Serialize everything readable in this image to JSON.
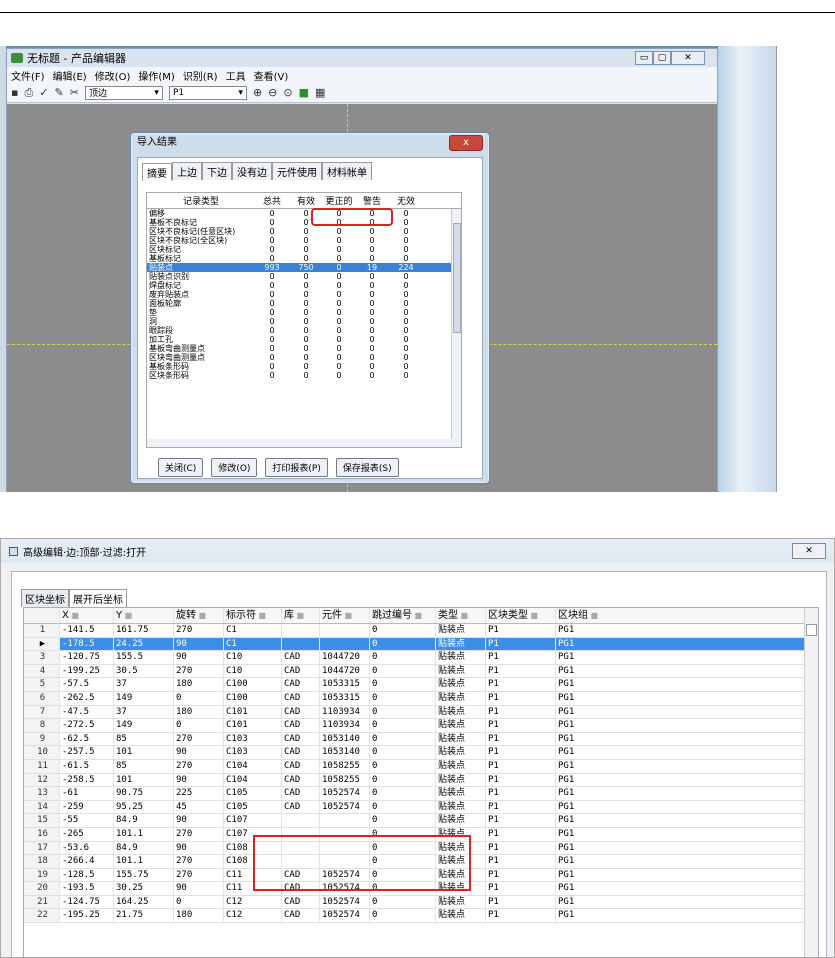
{
  "top": {
    "window_title": "无标题 - 产品编辑器",
    "menu": [
      "文件(F)",
      "编辑(E)",
      "修改(O)",
      "操作(M)",
      "识别(R)",
      "工具",
      "查看(V)"
    ],
    "toolbar": {
      "side_select": "顶边",
      "panel_select": "P1"
    },
    "dialog": {
      "title": "导入结果",
      "close": "x",
      "tabs": [
        "摘要",
        "上边",
        "下边",
        "没有边",
        "元件使用",
        "材料帐单"
      ],
      "columns": [
        "记录类型",
        "总共",
        "有效",
        "更正的",
        "警告",
        "无效"
      ],
      "rows": [
        [
          "偏移",
          "0",
          "0",
          "0",
          "0",
          "0"
        ],
        [
          "基板不良标记",
          "0",
          "0",
          "0",
          "0",
          "0"
        ],
        [
          "区块不良标记(任意区块)",
          "0",
          "0",
          "0",
          "0",
          "0"
        ],
        [
          "区块不良标记(全区块)",
          "0",
          "0",
          "0",
          "0",
          "0"
        ],
        [
          "区块标记",
          "0",
          "0",
          "0",
          "0",
          "0"
        ],
        [
          "基板标记",
          "0",
          "0",
          "0",
          "0",
          "0"
        ],
        [
          "贴装点",
          "993",
          "750",
          "0",
          "19",
          "224"
        ],
        [
          "贴装点识别",
          "0",
          "0",
          "0",
          "0",
          "0"
        ],
        [
          "焊盘标记",
          "0",
          "0",
          "0",
          "0",
          "0"
        ],
        [
          "废弃贴装点",
          "0",
          "0",
          "0",
          "0",
          "0"
        ],
        [
          "面板轮廓",
          "0",
          "0",
          "0",
          "0",
          "0"
        ],
        [
          "垫",
          "0",
          "0",
          "0",
          "0",
          "0"
        ],
        [
          "洞",
          "0",
          "0",
          "0",
          "0",
          "0"
        ],
        [
          "眼踪段",
          "0",
          "0",
          "0",
          "0",
          "0"
        ],
        [
          "加工孔",
          "0",
          "0",
          "0",
          "0",
          "0"
        ],
        [
          "基板弯曲测量点",
          "0",
          "0",
          "0",
          "0",
          "0"
        ],
        [
          "区块弯曲测量点",
          "0",
          "0",
          "0",
          "0",
          "0"
        ],
        [
          "基板条形码",
          "0",
          "0",
          "0",
          "0",
          "0"
        ],
        [
          "区块条形码",
          "0",
          "0",
          "0",
          "0",
          "0"
        ]
      ],
      "selected_row": 6,
      "buttons": [
        "关闭(C)",
        "修改(O)",
        "打印报表(P)",
        "保存报表(S)"
      ]
    }
  },
  "bottom": {
    "window_title": "高级编辑·边:顶部·过滤:打开",
    "close": "✕",
    "tabs": [
      "区块坐标",
      "展开后坐标"
    ],
    "columns": [
      "",
      "X",
      "Y",
      "旋转",
      "标示符",
      "库",
      "元件",
      "跳过编号",
      "类型",
      "区块类型",
      "区块组"
    ],
    "rows": [
      [
        "1",
        "-141.5",
        "161.75",
        "270",
        "C1",
        "",
        "",
        "0",
        "贴装点",
        "P1",
        "PG1"
      ],
      [
        "▶",
        "-178.5",
        "24.25",
        "90",
        "C1",
        "",
        "",
        "0",
        "贴装点",
        "P1",
        "PG1"
      ],
      [
        "3",
        "-120.75",
        "155.5",
        "90",
        "C10",
        "CAD",
        "1044720",
        "0",
        "贴装点",
        "P1",
        "PG1"
      ],
      [
        "4",
        "-199.25",
        "30.5",
        "270",
        "C10",
        "CAD",
        "1044720",
        "0",
        "贴装点",
        "P1",
        "PG1"
      ],
      [
        "5",
        "-57.5",
        "37",
        "180",
        "C100",
        "CAD",
        "1053315",
        "0",
        "贴装点",
        "P1",
        "PG1"
      ],
      [
        "6",
        "-262.5",
        "149",
        "0",
        "C100",
        "CAD",
        "1053315",
        "0",
        "贴装点",
        "P1",
        "PG1"
      ],
      [
        "7",
        "-47.5",
        "37",
        "180",
        "C101",
        "CAD",
        "1103934",
        "0",
        "贴装点",
        "P1",
        "PG1"
      ],
      [
        "8",
        "-272.5",
        "149",
        "0",
        "C101",
        "CAD",
        "1103934",
        "0",
        "贴装点",
        "P1",
        "PG1"
      ],
      [
        "9",
        "-62.5",
        "85",
        "270",
        "C103",
        "CAD",
        "1053140",
        "0",
        "贴装点",
        "P1",
        "PG1"
      ],
      [
        "10",
        "-257.5",
        "101",
        "90",
        "C103",
        "CAD",
        "1053140",
        "0",
        "贴装点",
        "P1",
        "PG1"
      ],
      [
        "11",
        "-61.5",
        "85",
        "270",
        "C104",
        "CAD",
        "1058255",
        "0",
        "贴装点",
        "P1",
        "PG1"
      ],
      [
        "12",
        "-258.5",
        "101",
        "90",
        "C104",
        "CAD",
        "1058255",
        "0",
        "贴装点",
        "P1",
        "PG1"
      ],
      [
        "13",
        "-61",
        "90.75",
        "225",
        "C105",
        "CAD",
        "1052574",
        "0",
        "贴装点",
        "P1",
        "PG1"
      ],
      [
        "14",
        "-259",
        "95.25",
        "45",
        "C105",
        "CAD",
        "1052574",
        "0",
        "贴装点",
        "P1",
        "PG1"
      ],
      [
        "15",
        "-55",
        "84.9",
        "90",
        "C107",
        "",
        "",
        "0",
        "贴装点",
        "P1",
        "PG1"
      ],
      [
        "16",
        "-265",
        "101.1",
        "270",
        "C107",
        "",
        "",
        "0",
        "贴装点",
        "P1",
        "PG1"
      ],
      [
        "17",
        "-53.6",
        "84.9",
        "90",
        "C108",
        "",
        "",
        "0",
        "贴装点",
        "P1",
        "PG1"
      ],
      [
        "18",
        "-266.4",
        "101.1",
        "270",
        "C108",
        "",
        "",
        "0",
        "贴装点",
        "P1",
        "PG1"
      ],
      [
        "19",
        "-128.5",
        "155.75",
        "270",
        "C11",
        "CAD",
        "1052574",
        "0",
        "贴装点",
        "P1",
        "PG1"
      ],
      [
        "20",
        "-193.5",
        "30.25",
        "90",
        "C11",
        "CAD",
        "1052574",
        "0",
        "贴装点",
        "P1",
        "PG1"
      ],
      [
        "21",
        "-124.75",
        "164.25",
        "0",
        "C12",
        "CAD",
        "1052574",
        "0",
        "贴装点",
        "P1",
        "PG1"
      ],
      [
        "22",
        "-195.25",
        "21.75",
        "180",
        "C12",
        "CAD",
        "1052574",
        "0",
        "贴装点",
        "P1",
        "PG1"
      ]
    ],
    "selected_row": 1
  }
}
